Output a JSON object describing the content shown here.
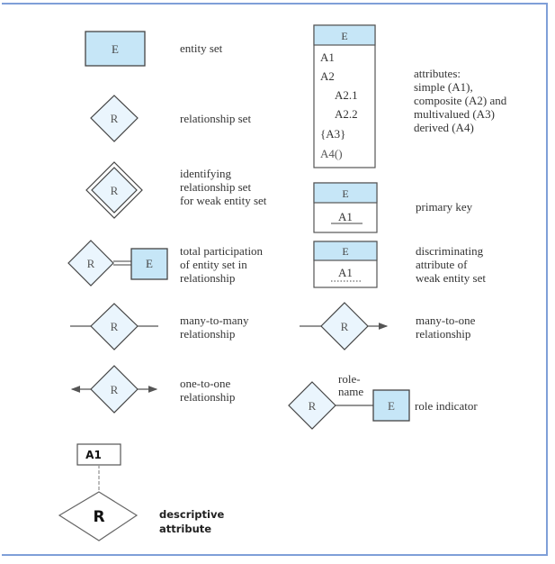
{
  "legend": {
    "entity_set": {
      "symbol": "E",
      "label": "entity set"
    },
    "relationship_set": {
      "symbol": "R",
      "label": "relationship set"
    },
    "identifying_relationship": {
      "symbol": "R",
      "label": "identifying\nrelationship set\nfor weak entity set"
    },
    "total_participation": {
      "rel_symbol": "R",
      "entity_symbol": "E",
      "label": "total participation\nof entity set in\nrelationship"
    },
    "many_to_many": {
      "symbol": "R",
      "label": "many-to-many\nrelationship"
    },
    "one_to_one": {
      "symbol": "R",
      "label": "one-to-one\nrelationship"
    },
    "descriptive_attribute": {
      "attr_symbol": "A1",
      "rel_symbol": "R",
      "label": "descriptive\nattribute"
    },
    "attributes": {
      "entity": "E",
      "rows": [
        "A1",
        "A2",
        "A2.1",
        "A2.2",
        "{A3}",
        "A4()"
      ],
      "label": "attributes:\nsimple (A1),\ncomposite (A2) and\nmultivalued (A3)\nderived (A4)"
    },
    "primary_key": {
      "entity": "E",
      "attr": "A1",
      "label": "primary key"
    },
    "discriminating": {
      "entity": "E",
      "attr": "A1",
      "label": "discriminating\nattribute of\nweak entity set"
    },
    "many_to_one": {
      "symbol": "R",
      "label": "many-to-one\nrelationship"
    },
    "role_indicator": {
      "rel_symbol": "R",
      "entity_symbol": "E",
      "role_name": "role-\nname",
      "label": "role indicator"
    }
  },
  "colors": {
    "entity_fill": "#c6e6f7",
    "relationship_fill": "#eaf5fd",
    "stroke": "#444444",
    "frame": "#7f9fd8"
  }
}
